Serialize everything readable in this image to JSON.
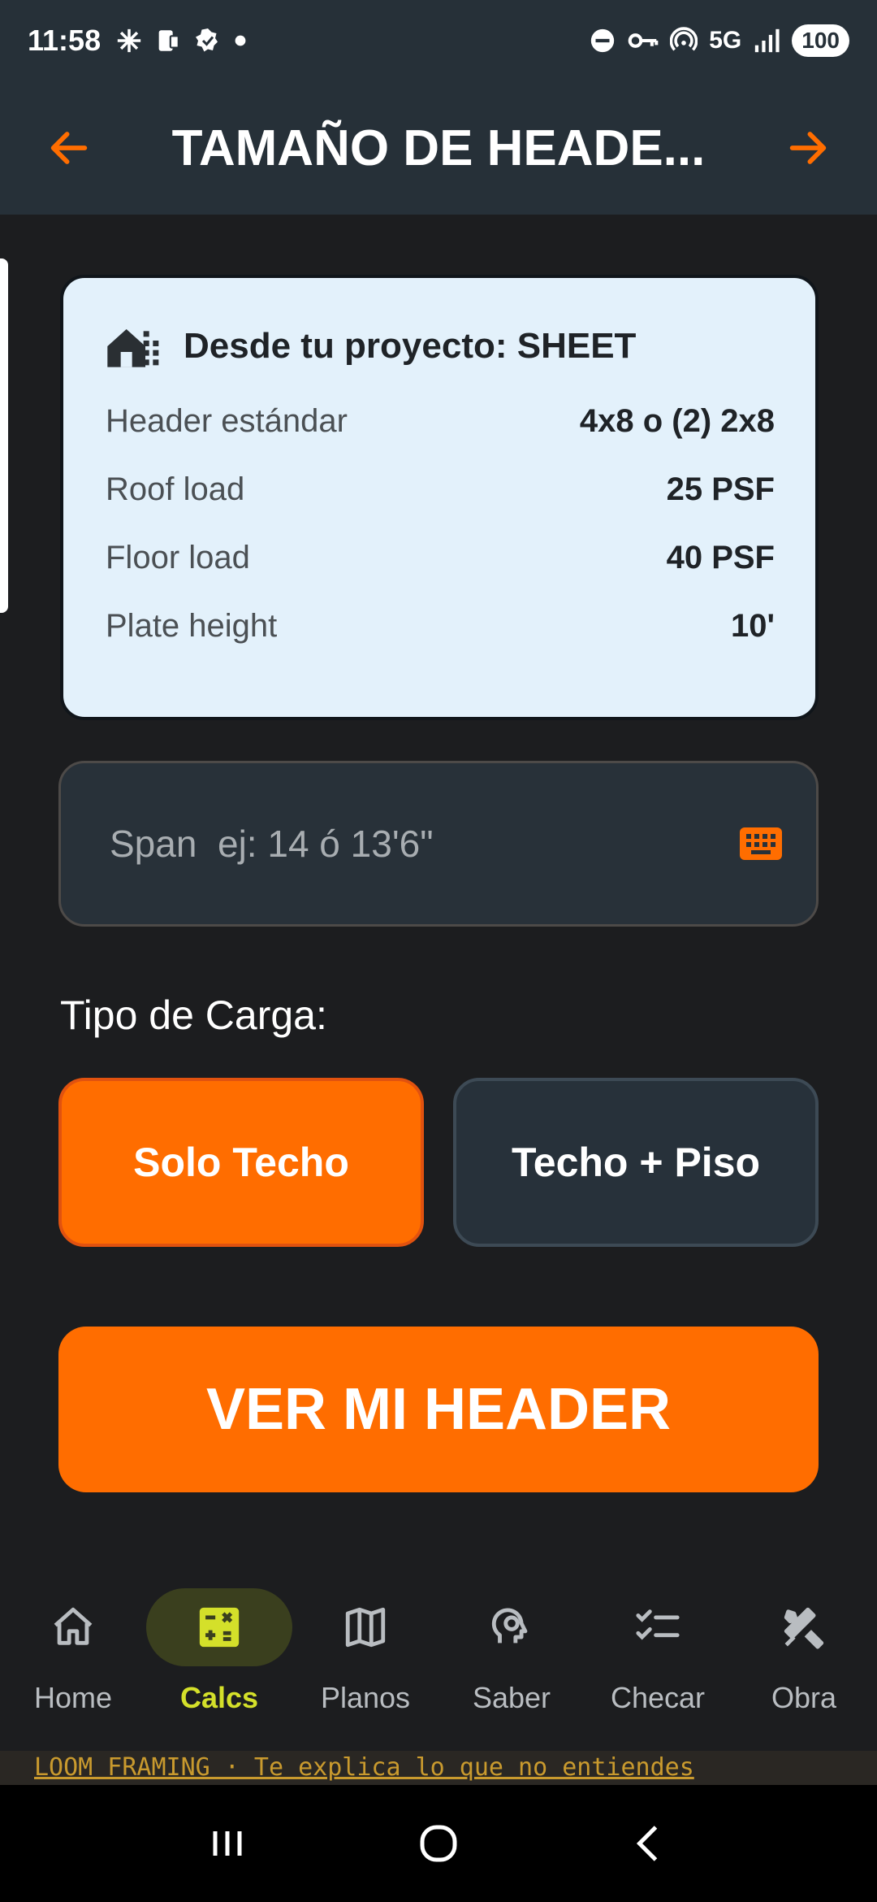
{
  "status_bar": {
    "time": "11:58",
    "network": "5G",
    "battery": "100"
  },
  "app_bar": {
    "title": "TAMAÑO DE HEADE..."
  },
  "project_card": {
    "title": "Desde tu proyecto: SHEET",
    "rows": [
      {
        "label": "Header estándar",
        "value": "4x8 o (2) 2x8"
      },
      {
        "label": "Roof load",
        "value": "25 PSF"
      },
      {
        "label": "Floor load",
        "value": "40 PSF"
      },
      {
        "label": "Plate height",
        "value": "10'"
      }
    ]
  },
  "span_input": {
    "placeholder": "Span  ej: 14 ó 13'6\"",
    "value": ""
  },
  "load_section": {
    "label": "Tipo de Carga:",
    "options": [
      {
        "label": "Solo Techo",
        "selected": true
      },
      {
        "label": "Techo + Piso",
        "selected": false
      }
    ]
  },
  "cta": {
    "label": "VER MI HEADER"
  },
  "bottom_nav": {
    "items": [
      {
        "label": "Home",
        "icon": "home-icon"
      },
      {
        "label": "Calcs",
        "icon": "calculator-icon",
        "active": true
      },
      {
        "label": "Planos",
        "icon": "map-icon"
      },
      {
        "label": "Saber",
        "icon": "brain-head-icon"
      },
      {
        "label": "Checar",
        "icon": "checklist-icon"
      },
      {
        "label": "Obra",
        "icon": "tools-icon"
      }
    ]
  },
  "ticker": {
    "text": "LOOM FRAMING  ·  Te explica lo que no entiendes"
  },
  "colors": {
    "accent": "#ff6d00",
    "active_nav": "#d4e02a",
    "card_bg": "#e3f1fb",
    "bar_bg": "#263038"
  }
}
